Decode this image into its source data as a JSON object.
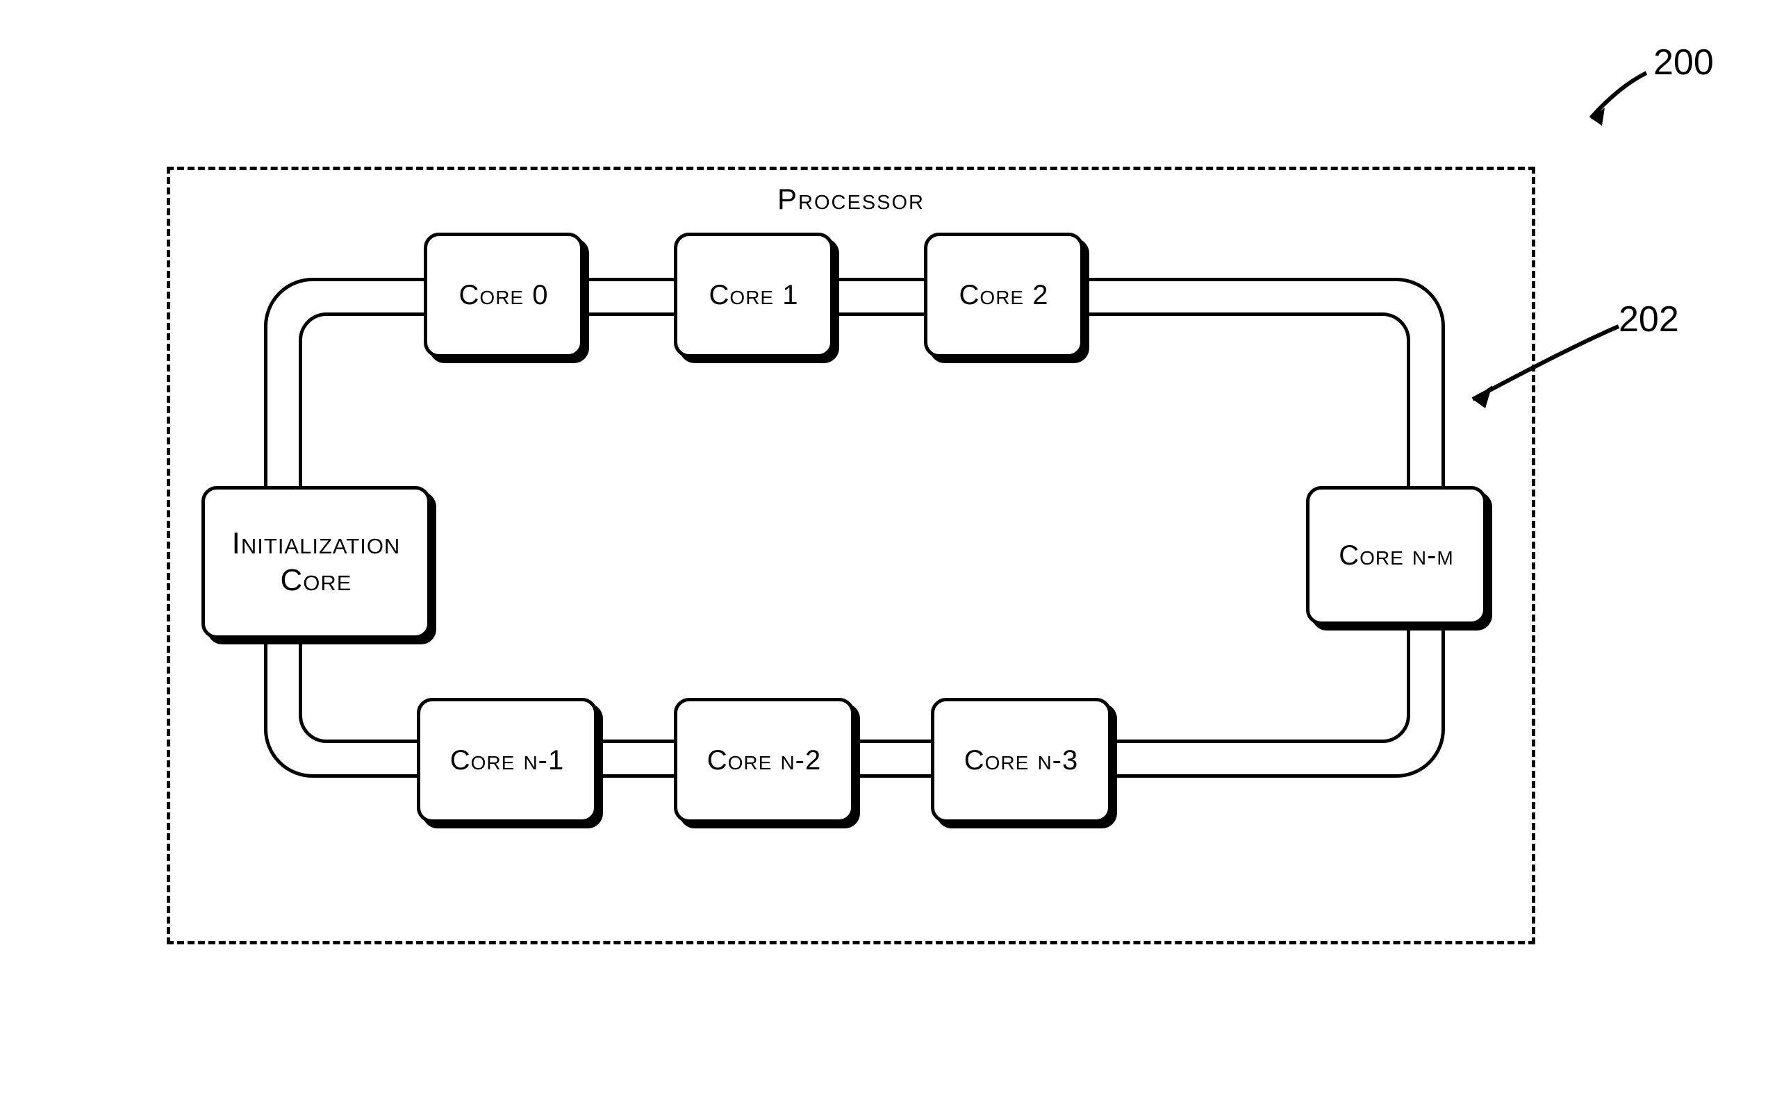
{
  "figure_ref_200": "200",
  "figure_ref_202": "202",
  "processor_label": "Processor",
  "nodes": {
    "init": "Initialization Core",
    "c0": "Core 0",
    "c1": "Core 1",
    "c2": "Core 2",
    "cnm": "Core n-m",
    "cn3": "Core n-3",
    "cn2": "Core n-2",
    "cn1": "Core n-1"
  }
}
